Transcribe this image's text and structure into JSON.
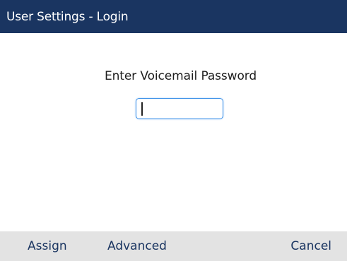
{
  "header": {
    "title": "User Settings - Login"
  },
  "main": {
    "prompt": "Enter Voicemail Password",
    "password_value": "",
    "password_placeholder": ""
  },
  "softkeys": {
    "assign": "Assign",
    "advanced": "Advanced",
    "cancel": "Cancel"
  },
  "colors": {
    "title_bar": "#1a3561",
    "softkey_bar": "#e3e3e3",
    "softkey_text": "#1a3561",
    "input_border": "#3a8fe8"
  }
}
